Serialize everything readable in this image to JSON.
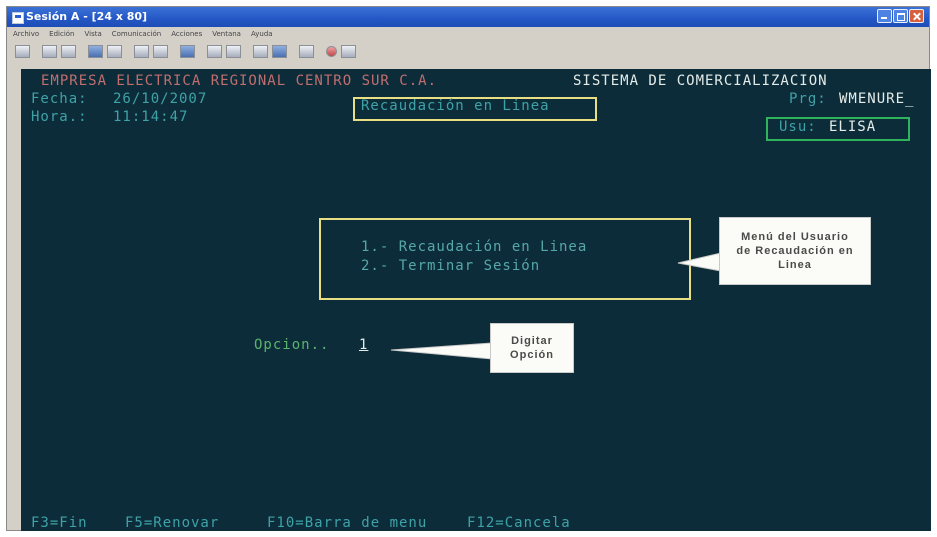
{
  "window": {
    "title": "Sesión A - [24 x 80]"
  },
  "menubar": [
    "Archivo",
    "Edición",
    "Vista",
    "Comunicación",
    "Acciones",
    "Ventana",
    "Ayuda"
  ],
  "terminal": {
    "company": "EMPRESA ELECTRICA REGIONAL CENTRO SUR C.A.",
    "system": "SISTEMA DE COMERCIALIZACION",
    "date_label": "Fecha:",
    "date_value": "26/10/2007",
    "time_label": "Hora.:",
    "time_value": "11:14:47",
    "screen_title": "Recaudación en Linea",
    "program_label": "Prg:",
    "program_value": "WMENURE_",
    "user_label": "Usu:",
    "user_value": "ELISA",
    "menu_items": [
      "1.- Recaudación en Linea",
      "2.- Terminar Sesión"
    ],
    "option_label": "Opcion..",
    "option_value": "1",
    "function_keys": [
      "F3=Fin",
      "F5=Renovar",
      "F10=Barra de menu",
      "F12=Cancela"
    ]
  },
  "callouts": {
    "menu_callout": [
      "Menú del Usuario",
      "de Recaudación en",
      "Linea"
    ],
    "option_callout": [
      "Digitar",
      "Opción"
    ]
  }
}
